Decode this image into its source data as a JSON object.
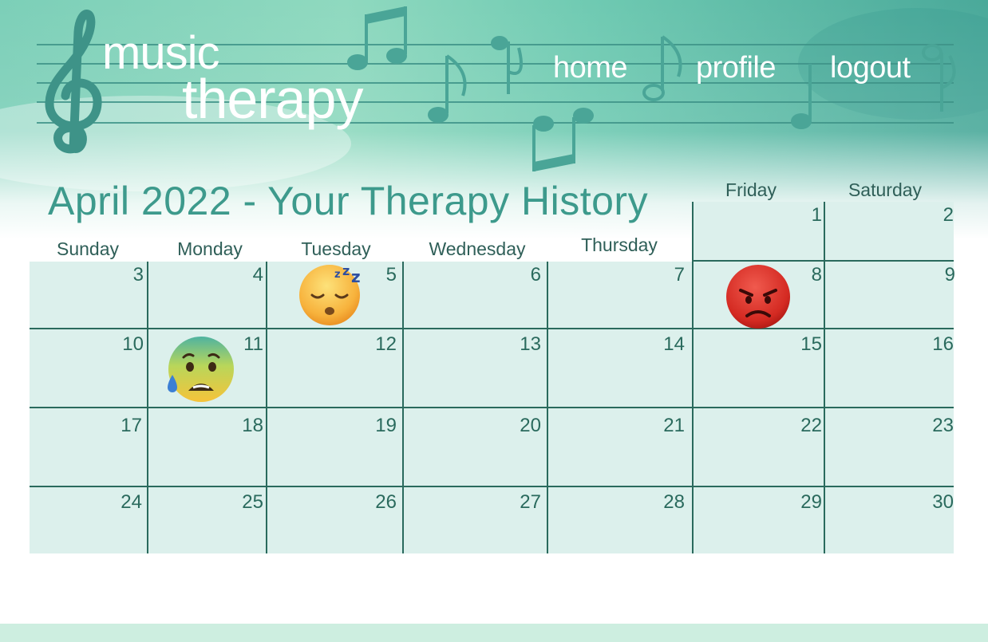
{
  "app": {
    "logo_line1": "music",
    "logo_line2": "therapy"
  },
  "nav": {
    "home": "home",
    "profile": "profile",
    "logout": "logout"
  },
  "calendar": {
    "title": "April 2022 - Your Therapy History",
    "weekdays": [
      "Sunday",
      "Monday",
      "Tuesday",
      "Wednesday",
      "Thursday",
      "Friday",
      "Saturday"
    ],
    "days": [
      "1",
      "2",
      "3",
      "4",
      "5",
      "6",
      "7",
      "8",
      "9",
      "10",
      "11",
      "12",
      "13",
      "14",
      "15",
      "16",
      "17",
      "18",
      "19",
      "20",
      "21",
      "22",
      "23",
      "24",
      "25",
      "26",
      "27",
      "28",
      "29",
      "30"
    ],
    "moods": [
      {
        "day": "5",
        "icon": "sleeping-face-icon"
      },
      {
        "day": "8",
        "icon": "angry-face-icon"
      },
      {
        "day": "11",
        "icon": "anxious-face-icon"
      }
    ]
  },
  "colors": {
    "accent": "#3d9a8c",
    "grid": "#2a6a5d",
    "cell": "#dcf0ec",
    "footer": "#cdeee0"
  }
}
